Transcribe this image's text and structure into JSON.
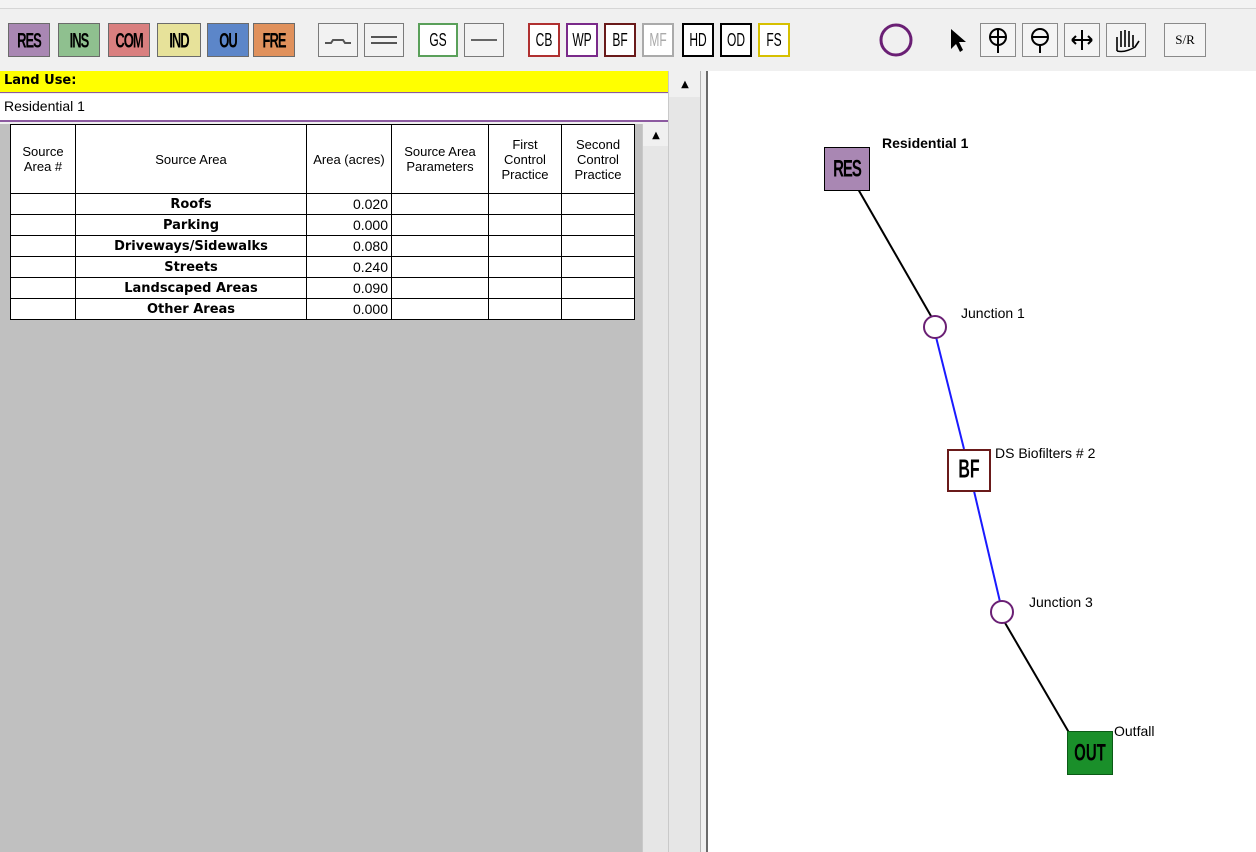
{
  "toolbar": {
    "land_uses": [
      {
        "label": "RES",
        "color": "#a987b3"
      },
      {
        "label": "INS",
        "color": "#8fc08f"
      },
      {
        "label": "COM",
        "color": "#d97f7f"
      },
      {
        "label": "IND",
        "color": "#e7e29a"
      },
      {
        "label": "OU",
        "color": "#5c86c9"
      },
      {
        "label": "FRE",
        "color": "#e0915c"
      }
    ],
    "conveyance": [
      "GS"
    ],
    "controls": [
      "CB",
      "WP",
      "BF",
      "MF",
      "HD",
      "OD",
      "FS"
    ],
    "tools": [
      "pointer-icon",
      "zoom-in-icon",
      "zoom-out-icon",
      "pan-icon",
      "hand-icon"
    ],
    "tool_text": [
      "S/R"
    ]
  },
  "land_use_panel": {
    "header": "Land Use:",
    "value": "Residential 1",
    "columns": [
      "Source Area #",
      "Source Area",
      "Area (acres)",
      "Source Area Parameters",
      "First Control Practice",
      "Second Control Practice"
    ],
    "rows": [
      {
        "num": "",
        "name": "Roofs",
        "area": "0.020"
      },
      {
        "num": "",
        "name": "Parking",
        "area": "0.000"
      },
      {
        "num": "",
        "name": "Driveways/Sidewalks",
        "area": "0.080"
      },
      {
        "num": "",
        "name": "Streets",
        "area": "0.240"
      },
      {
        "num": "",
        "name": "Landscaped Areas",
        "area": "0.090"
      },
      {
        "num": "",
        "name": "Other Areas",
        "area": "0.000"
      }
    ]
  },
  "network": {
    "land_use_node": {
      "text": "RES",
      "label": "Residential 1",
      "color": "#a987b3"
    },
    "junction1": {
      "label": "Junction 1"
    },
    "control_node": {
      "text": "BF",
      "label": "DS Biofilters # 2"
    },
    "junction3": {
      "label": "Junction 3"
    },
    "outfall": {
      "text": "OUT",
      "label": "Outfall",
      "color": "#1a8f2a"
    }
  }
}
